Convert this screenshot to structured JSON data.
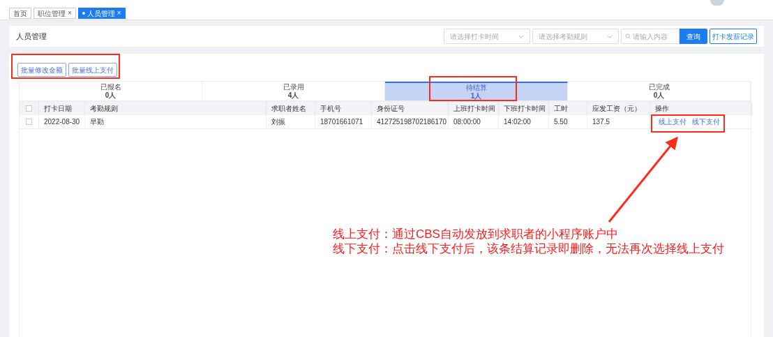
{
  "page_tabs": [
    {
      "label": "首页",
      "selected": false
    },
    {
      "label": "职位管理",
      "selected": false,
      "close": "×"
    },
    {
      "label": "人员管理",
      "selected": true,
      "close": "×"
    }
  ],
  "header": {
    "title": "人员管理",
    "filters": [
      {
        "placeholder": "请选择打卡时间"
      },
      {
        "placeholder": "请选择考勤规则"
      }
    ],
    "search": {
      "placeholder": "请输入内容"
    },
    "search_button": "查询",
    "record_button": "打卡发薪记录"
  },
  "batch_buttons": [
    "批量修改金额",
    "批量线上支付"
  ],
  "status_tabs": [
    {
      "label": "已报名",
      "count": "0人",
      "selected": false
    },
    {
      "label": "已录用",
      "count": "4人",
      "selected": false
    },
    {
      "label": "待结算",
      "count": "1人",
      "selected": true
    },
    {
      "label": "已完成",
      "count": "0人",
      "selected": false
    }
  ],
  "table": {
    "select_all": false,
    "columns": [
      "打卡日期",
      "考勤规则",
      "求职者姓名",
      "手机号",
      "身份证号",
      "上班打卡时间",
      "下班打卡时间",
      "工时",
      "应发工资（元）",
      "操作"
    ],
    "rows": [
      {
        "checked": false,
        "cells": [
          "2022-08-30",
          "早勤",
          "刘振",
          "18701661071",
          "412725198702186170",
          "08:00:00",
          "14:02:00",
          "5.50",
          "137.5"
        ],
        "actions": [
          "线上支付",
          "线下支付"
        ]
      }
    ]
  },
  "annotation": {
    "lines": [
      "线上支付：通过CBS自动发放到求职者的小程序账户中",
      "线下支付：点击线下支付后，该条结算记录即删除，无法再次选择线上支付"
    ]
  }
}
